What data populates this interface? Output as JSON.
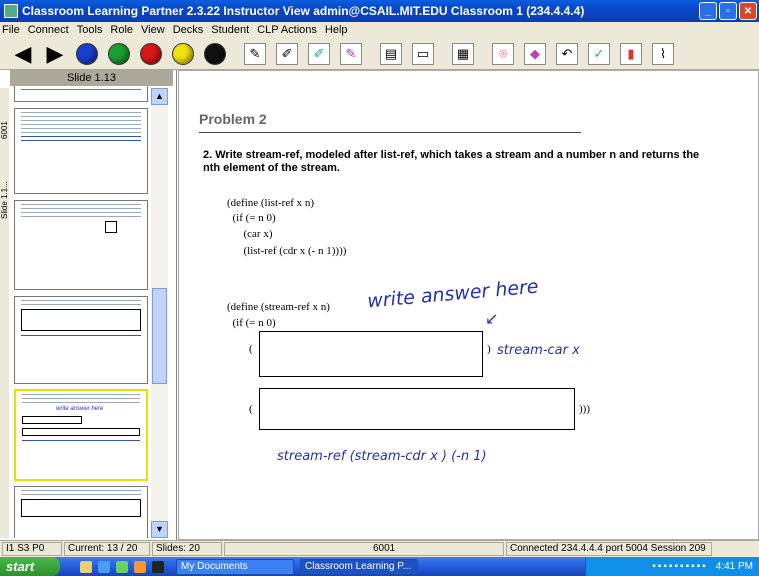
{
  "window": {
    "title": "Classroom Learning Partner 2.3.22  Instructor View  admin@CSAIL.MIT.EDU  Classroom 1 (234.4.4.4)"
  },
  "menu": [
    "File",
    "Connect",
    "Tools",
    "Role",
    "View",
    "Decks",
    "Student",
    "CLP Actions",
    "Help"
  ],
  "toolbar": {
    "colors": [
      "#1a3fd0",
      "#1aa030",
      "#d81818",
      "#f0e010",
      "#111111"
    ]
  },
  "sidebar": {
    "slide_header": "Slide 1.13",
    "tabs": [
      "6001",
      "Slide 1.1..."
    ],
    "thumb_texts": {
      "t1": "write answer here"
    }
  },
  "slide": {
    "title": "Problem 2",
    "question": "2.  Write stream-ref, modeled after list-ref, which takes a stream and a number n and returns the nth element of the stream.",
    "code_list": [
      "(define (list-ref x n)",
      "  (if (= n 0)",
      "      (car x)",
      "      (list-ref (cdr x (- n 1))))"
    ],
    "code_stream": [
      "(define (stream-ref x n)",
      "  (if (= n 0)"
    ],
    "paren_open1": "(",
    "paren_close1": ")",
    "paren_open2": "(",
    "paren_close2": ")))",
    "ink_answer": "write answer here",
    "ink_box1": "stream-car x",
    "ink_bottom": "stream-ref (stream-cdr x ) (-n 1)"
  },
  "status": {
    "cells": [
      "I1 S3 P0",
      "Current: 13 / 20",
      "Slides: 20",
      "6001",
      "Connected 234.4.4.4 port 5004 Session 209"
    ]
  },
  "taskbar": {
    "start": "start",
    "tasks": [
      "My Documents",
      "Classroom Learning P..."
    ],
    "clock": "4:41 PM"
  }
}
